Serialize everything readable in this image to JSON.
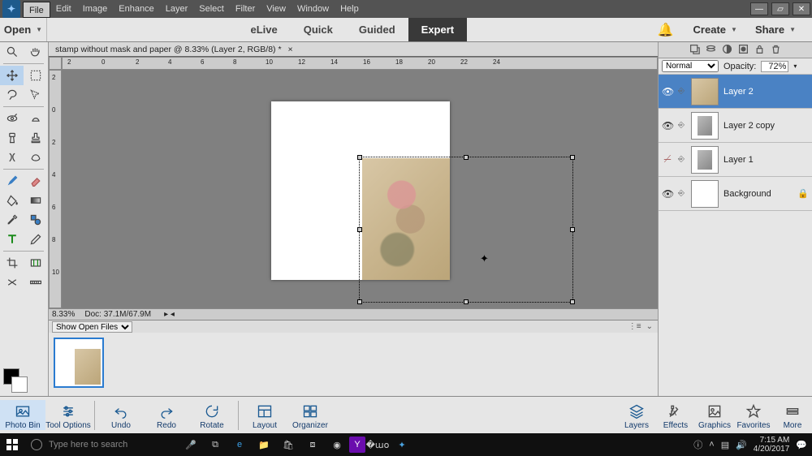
{
  "menu": {
    "items": [
      "File",
      "Edit",
      "Image",
      "Enhance",
      "Layer",
      "Select",
      "Filter",
      "View",
      "Window",
      "Help"
    ]
  },
  "modestrip": {
    "open": "Open",
    "modes": [
      "eLive",
      "Quick",
      "Guided",
      "Expert"
    ],
    "active": "Expert",
    "create": "Create",
    "share": "Share"
  },
  "doc": {
    "tab": "stamp without mask and paper @ 8.33% (Layer 2, RGB/8) *",
    "zoom": "8.33%",
    "docinfo": "Doc: 37.1M/67.9M"
  },
  "ruler": {
    "h": [
      "2",
      "0",
      "2",
      "4",
      "6",
      "8",
      "10",
      "12",
      "14",
      "16",
      "18",
      "20",
      "22",
      "24"
    ],
    "v": [
      "2",
      "0",
      "2",
      "4",
      "6",
      "8",
      "10"
    ]
  },
  "bin": {
    "dropdown": "Show Open Files"
  },
  "layers": {
    "blend": "Normal",
    "opacity_label": "Opacity:",
    "opacity": "72%",
    "items": [
      {
        "name": "Layer 2",
        "visible": true,
        "thumb": "photo",
        "selected": true
      },
      {
        "name": "Layer 2 copy",
        "visible": true,
        "thumb": "grayphoto"
      },
      {
        "name": "Layer 1",
        "visible": false,
        "thumb": "grayphoto"
      },
      {
        "name": "Background",
        "visible": true,
        "thumb": "white",
        "locked": true
      }
    ]
  },
  "cmds": {
    "left": [
      "Photo Bin",
      "Tool Options",
      "Undo",
      "Redo",
      "Rotate",
      "Layout",
      "Organizer"
    ],
    "right": [
      "Layers",
      "Effects",
      "Graphics",
      "Favorites",
      "More"
    ]
  },
  "taskbar": {
    "search": "Type here to search",
    "time": "7:15 AM",
    "date": "4/20/2017"
  }
}
